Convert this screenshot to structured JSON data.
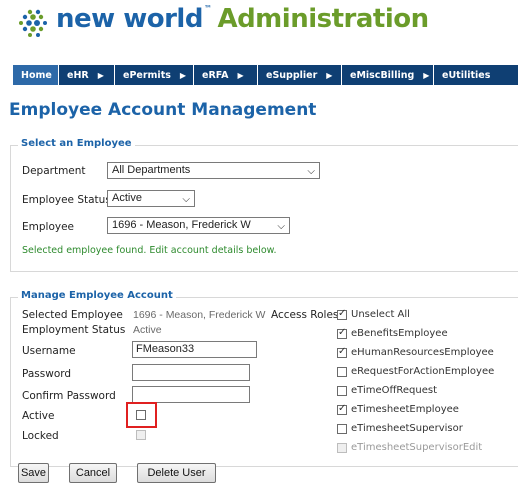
{
  "logo": {
    "brand": "new world",
    "trademark": "™",
    "product": "Administration"
  },
  "nav": {
    "items": [
      {
        "label": "Home",
        "arrow": false
      },
      {
        "label": "eHR",
        "arrow": true
      },
      {
        "label": "ePermits",
        "arrow": true
      },
      {
        "label": "eRFA",
        "arrow": true
      },
      {
        "label": "eSupplier",
        "arrow": true
      },
      {
        "label": "eMiscBilling",
        "arrow": true
      },
      {
        "label": "eUtilities",
        "arrow": false
      }
    ]
  },
  "page_title": "Employee Account Management",
  "select_employee": {
    "legend": "Select an Employee",
    "department_label": "Department",
    "department_value": "All Departments",
    "status_label": "Employee Status",
    "status_value": "Active",
    "employee_label": "Employee",
    "employee_value": "1696 - Meason, Frederick W",
    "message": "Selected employee found. Edit account details below."
  },
  "manage": {
    "legend": "Manage Employee Account",
    "selected_employee_label": "Selected Employee",
    "selected_employee_value": "1696 - Meason, Frederick W",
    "employment_status_label": "Employment Status",
    "employment_status_value": "Active",
    "username_label": "Username",
    "username_value": "FMeason33",
    "password_label": "Password",
    "password_value": "",
    "confirm_label": "Confirm Password",
    "confirm_value": "",
    "active_label": "Active",
    "active_checked": false,
    "locked_label": "Locked",
    "locked_checked": false,
    "access_roles_label": "Access Roles",
    "roles": [
      {
        "label": "Unselect All",
        "checked": true,
        "disabled": false
      },
      {
        "label": "eBenefitsEmployee",
        "checked": true,
        "disabled": false
      },
      {
        "label": "eHumanResourcesEmployee",
        "checked": true,
        "disabled": false
      },
      {
        "label": "eRequestForActionEmployee",
        "checked": false,
        "disabled": false
      },
      {
        "label": "eTimeOffRequest",
        "checked": false,
        "disabled": false
      },
      {
        "label": "eTimesheetEmployee",
        "checked": true,
        "disabled": false
      },
      {
        "label": "eTimesheetSupervisor",
        "checked": false,
        "disabled": false
      },
      {
        "label": "eTimesheetSupervisorEdit",
        "checked": false,
        "disabled": true
      }
    ]
  },
  "buttons": {
    "save": "Save",
    "cancel": "Cancel",
    "delete": "Delete User"
  },
  "colors": {
    "brand_blue": "#1c63a8",
    "brand_green": "#6b9c2a",
    "nav_bg": "#0f3f73",
    "highlight": "#e02020",
    "ok_green": "#2d8a2d"
  }
}
